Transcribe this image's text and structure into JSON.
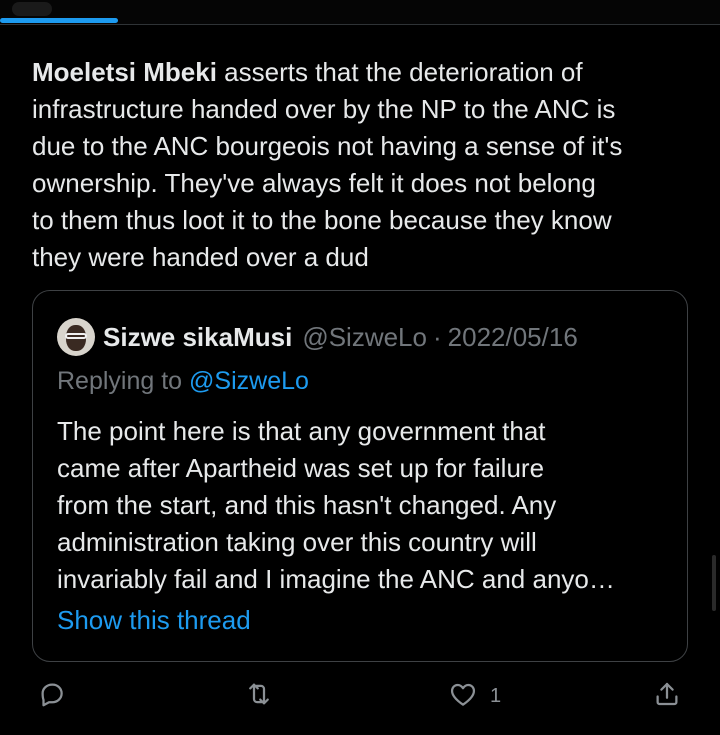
{
  "tweet": {
    "author_mention": "Moeletsi Mbeki",
    "body": " asserts that the deterioration of\ninfrastructure handed over by the NP to the ANC is\ndue to the ANC bourgeois not having a sense of it's\nownership. They've always felt it does not belong\nto them thus loot it to the bone because they know\nthey were handed over a dud"
  },
  "quote": {
    "name": "Sizwe sikaMusi",
    "handle": "@SizweLo",
    "separator": "·",
    "date": "2022/05/16",
    "replying_prefix": "Replying to ",
    "replying_to": "@SizweLo",
    "body": "The point here is that any government that\ncame after Apartheid was set up for failure\nfrom the start, and this hasn't changed. Any\nadministration taking over this country will\ninvariably fail and I imagine the ANC and anyo…",
    "show_thread": "Show this thread"
  },
  "actions": {
    "like_count": "1",
    "icons": [
      "reply-icon",
      "retweet-icon",
      "like-icon",
      "share-icon"
    ]
  },
  "colors": {
    "background": "#000000",
    "text": "#e7e9ea",
    "muted": "#71767b",
    "accent": "#1d9bf0"
  }
}
